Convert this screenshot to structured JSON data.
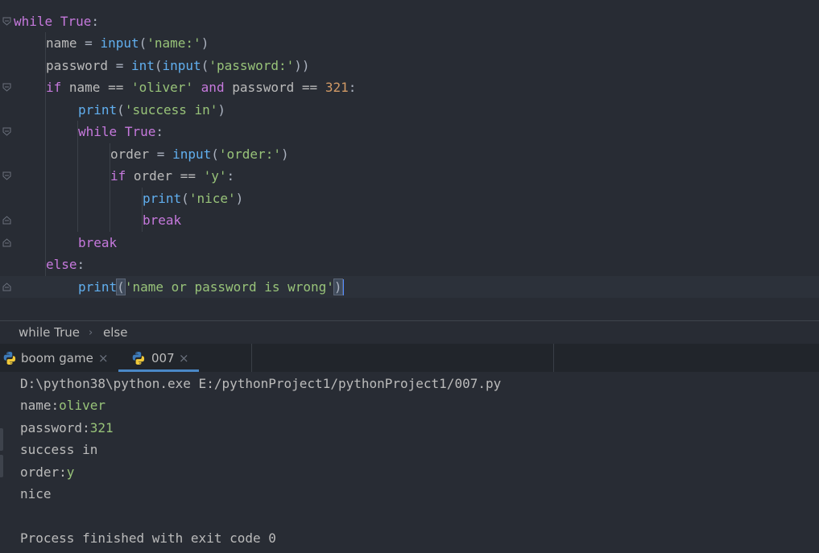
{
  "editor": {
    "lines": [
      [
        {
          "t": "while",
          "c": "kw"
        },
        {
          "t": " ",
          "c": "tx"
        },
        {
          "t": "True",
          "c": "kw"
        },
        {
          "t": ":",
          "c": "op"
        }
      ],
      [
        {
          "t": "name",
          "c": "tx"
        },
        {
          "t": " = ",
          "c": "op"
        },
        {
          "t": "input",
          "c": "fn"
        },
        {
          "t": "(",
          "c": "op"
        },
        {
          "t": "'name:'",
          "c": "st"
        },
        {
          "t": ")",
          "c": "op"
        }
      ],
      [
        {
          "t": "password",
          "c": "tx"
        },
        {
          "t": " = ",
          "c": "op"
        },
        {
          "t": "int",
          "c": "fn"
        },
        {
          "t": "(",
          "c": "op"
        },
        {
          "t": "input",
          "c": "fn"
        },
        {
          "t": "(",
          "c": "op"
        },
        {
          "t": "'password:'",
          "c": "st"
        },
        {
          "t": "))",
          "c": "op"
        }
      ],
      [
        {
          "t": "if",
          "c": "kw"
        },
        {
          "t": " name == ",
          "c": "tx"
        },
        {
          "t": "'oliver'",
          "c": "st"
        },
        {
          "t": " ",
          "c": "tx"
        },
        {
          "t": "and",
          "c": "kw"
        },
        {
          "t": " password == ",
          "c": "tx"
        },
        {
          "t": "321",
          "c": "nm"
        },
        {
          "t": ":",
          "c": "op"
        }
      ],
      [
        {
          "t": "print",
          "c": "fn"
        },
        {
          "t": "(",
          "c": "op"
        },
        {
          "t": "'success in'",
          "c": "st"
        },
        {
          "t": ")",
          "c": "op"
        }
      ],
      [
        {
          "t": "while",
          "c": "kw"
        },
        {
          "t": " ",
          "c": "tx"
        },
        {
          "t": "True",
          "c": "kw"
        },
        {
          "t": ":",
          "c": "op"
        }
      ],
      [
        {
          "t": "order",
          "c": "tx"
        },
        {
          "t": " = ",
          "c": "op"
        },
        {
          "t": "input",
          "c": "fn"
        },
        {
          "t": "(",
          "c": "op"
        },
        {
          "t": "'order:'",
          "c": "st"
        },
        {
          "t": ")",
          "c": "op"
        }
      ],
      [
        {
          "t": "if",
          "c": "kw"
        },
        {
          "t": " order == ",
          "c": "tx"
        },
        {
          "t": "'y'",
          "c": "st"
        },
        {
          "t": ":",
          "c": "op"
        }
      ],
      [
        {
          "t": "print",
          "c": "fn"
        },
        {
          "t": "(",
          "c": "op"
        },
        {
          "t": "'nice'",
          "c": "st"
        },
        {
          "t": ")",
          "c": "op"
        }
      ],
      [
        {
          "t": "break",
          "c": "kw"
        }
      ],
      [
        {
          "t": "break",
          "c": "kw"
        }
      ],
      [
        {
          "t": "else",
          "c": "kw"
        },
        {
          "t": ":",
          "c": "op"
        }
      ],
      [
        {
          "t": "print",
          "c": "fn"
        },
        {
          "t": "(",
          "c": "op",
          "hl": true
        },
        {
          "t": "'name or password is wrong'",
          "c": "st"
        },
        {
          "t": ")",
          "c": "op",
          "hl": true
        }
      ]
    ],
    "indents": [
      0,
      1,
      1,
      1,
      2,
      2,
      3,
      3,
      4,
      4,
      2,
      1,
      2
    ],
    "current_line": 12,
    "colors": {
      "background": "#282c34",
      "keyword": "#c679dd",
      "function": "#61afef",
      "string": "#98c379",
      "number": "#d19a66",
      "text": "#bbbbbb"
    }
  },
  "breadcrumb": {
    "items": [
      "while True",
      "else"
    ],
    "separator": "›"
  },
  "run_tabs": [
    {
      "label": "boom game",
      "icon": "python-icon",
      "close": "×",
      "active": false
    },
    {
      "label": "007",
      "icon": "python-icon",
      "close": "×",
      "active": true
    }
  ],
  "console": {
    "lines": [
      {
        "prefix": "D:\\python38\\python.exe E:/pythonProject1/pythonProject1/007.py",
        "input": ""
      },
      {
        "prefix": "name:",
        "input": "oliver"
      },
      {
        "prefix": "password:",
        "input": "321"
      },
      {
        "prefix": "success in",
        "input": ""
      },
      {
        "prefix": "order:",
        "input": "y"
      },
      {
        "prefix": "nice",
        "input": ""
      },
      {
        "prefix": "",
        "input": ""
      },
      {
        "prefix": "Process finished with exit code 0",
        "input": ""
      }
    ],
    "colors": {
      "input": "#98c379",
      "text": "#bbbbbb"
    }
  }
}
